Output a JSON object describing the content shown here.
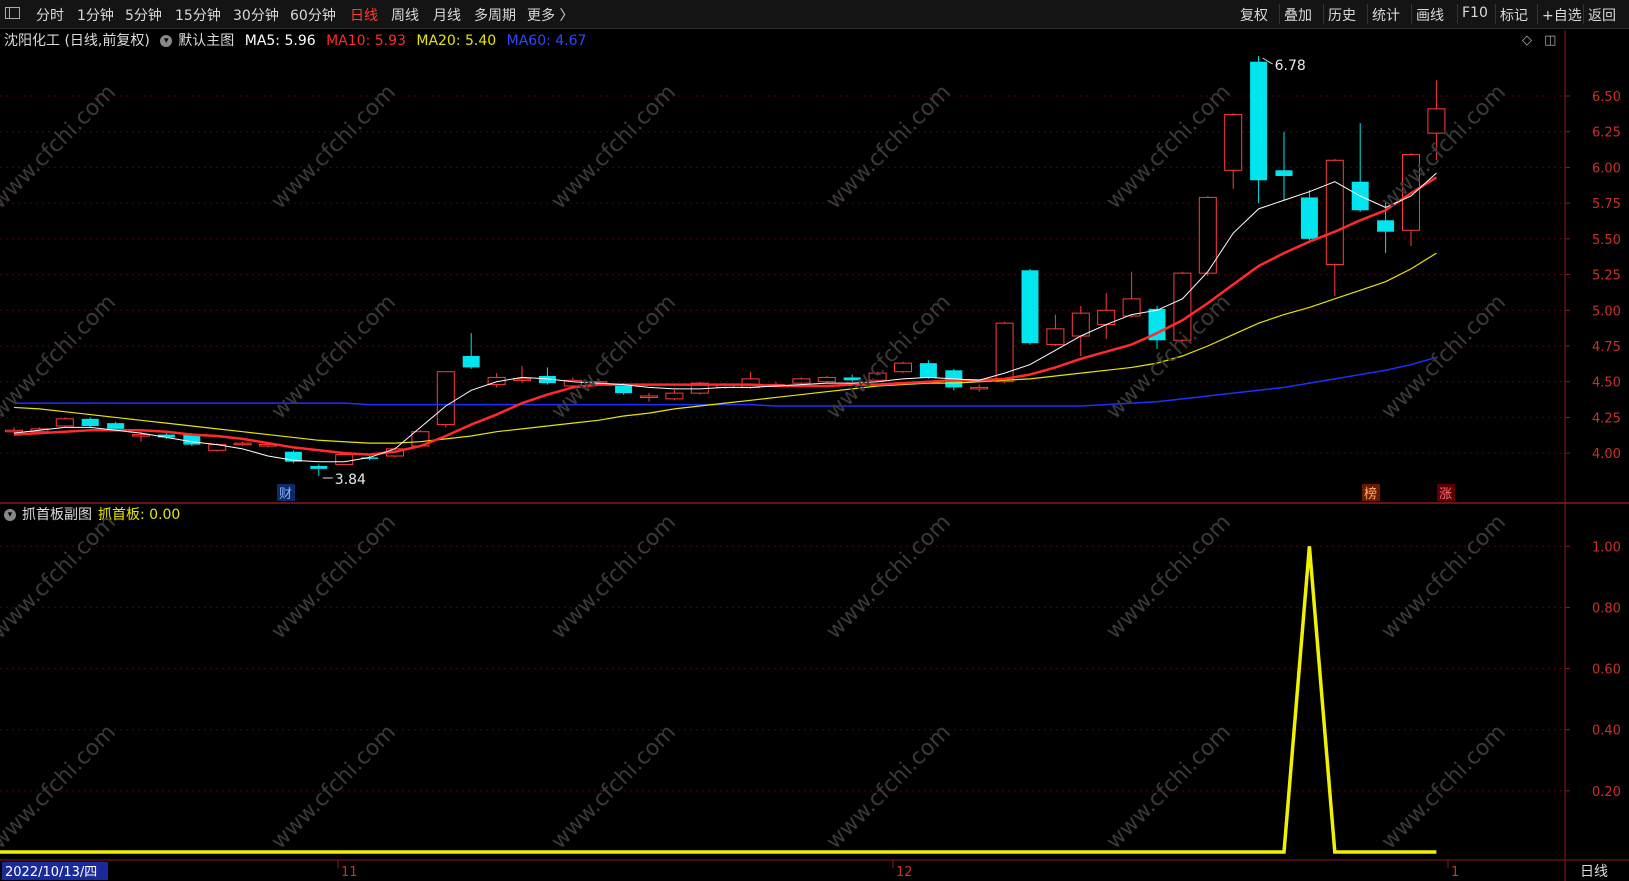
{
  "toolbar": {
    "left_items": [
      "分时",
      "1分钟",
      "5分钟",
      "15分钟",
      "30分钟",
      "60分钟",
      "日线",
      "周线",
      "月线",
      "多周期",
      "更多 〉"
    ],
    "active_item": "日线",
    "right_items": [
      "复权",
      "叠加",
      "历史",
      "统计",
      "画线",
      "F10",
      "标记",
      "+自选",
      "返回"
    ]
  },
  "main_info": {
    "title": "沈阳化工 (日线,前复权)",
    "template": "默认主图",
    "ma5": "MA5: 5.96",
    "ma10": "MA10: 5.93",
    "ma20": "MA20: 5.40",
    "ma60": "MA60: 4.67",
    "colors": {
      "ma5": "#ffffff",
      "ma10": "#ff2a2a",
      "ma20": "#e6e600",
      "ma60": "#1f2fff",
      "up": "#ff3b3b",
      "down": "#00e5ee"
    }
  },
  "sub_info": {
    "title": "抓首板副图",
    "indicator": "抓首板: 0.00"
  },
  "markers": {
    "high_label": "6.78",
    "low_label": "3.84",
    "finance_tag": "财",
    "list_tag": "榜",
    "limit_tag": "涨"
  },
  "watermark": "www.cfchi.com",
  "bottom": {
    "date_label": "2022/10/13/四",
    "month_labels": [
      "11",
      "12",
      "1"
    ],
    "period_label": "日线"
  },
  "chart_data": [
    {
      "type": "candlestick",
      "ylim": [
        3.84,
        6.78
      ],
      "y_ticks": [
        "6.50",
        "6.25",
        "6.00",
        "5.75",
        "5.50",
        "5.25",
        "5.00",
        "4.75",
        "4.50",
        "4.25",
        "4.00"
      ],
      "candles": [
        {
          "o": 4.16,
          "c": 4.16,
          "h": 4.18,
          "l": 4.14
        },
        {
          "o": 4.15,
          "c": 4.17,
          "h": 4.18,
          "l": 4.13
        },
        {
          "o": 4.19,
          "c": 4.24,
          "h": 4.25,
          "l": 4.18
        },
        {
          "o": 4.24,
          "c": 4.19,
          "h": 4.25,
          "l": 4.18
        },
        {
          "o": 4.21,
          "c": 4.17,
          "h": 4.22,
          "l": 4.16
        },
        {
          "o": 4.13,
          "c": 4.13,
          "h": 4.15,
          "l": 4.08
        },
        {
          "o": 4.13,
          "c": 4.11,
          "h": 4.14,
          "l": 4.1
        },
        {
          "o": 4.13,
          "c": 4.06,
          "h": 4.14,
          "l": 4.05
        },
        {
          "o": 4.02,
          "c": 4.06,
          "h": 4.07,
          "l": 4.01
        },
        {
          "o": 4.06,
          "c": 4.07,
          "h": 4.08,
          "l": 4.05
        },
        {
          "o": 4.06,
          "c": 4.06,
          "h": 4.08,
          "l": 4.04
        },
        {
          "o": 4.01,
          "c": 3.94,
          "h": 4.02,
          "l": 3.93
        },
        {
          "o": 3.91,
          "c": 3.89,
          "h": 3.92,
          "l": 3.84
        },
        {
          "o": 3.92,
          "c": 3.99,
          "h": 4.0,
          "l": 3.92
        },
        {
          "o": 3.97,
          "c": 3.96,
          "h": 3.98,
          "l": 3.95
        },
        {
          "o": 3.98,
          "c": 4.03,
          "h": 4.04,
          "l": 3.97
        },
        {
          "o": 4.05,
          "c": 4.15,
          "h": 4.16,
          "l": 4.04
        },
        {
          "o": 4.2,
          "c": 4.57,
          "h": 4.57,
          "l": 4.18
        },
        {
          "o": 4.68,
          "c": 4.6,
          "h": 4.84,
          "l": 4.59
        },
        {
          "o": 4.48,
          "c": 4.53,
          "h": 4.56,
          "l": 4.46
        },
        {
          "o": 4.52,
          "c": 4.52,
          "h": 4.61,
          "l": 4.49
        },
        {
          "o": 4.54,
          "c": 4.49,
          "h": 4.6,
          "l": 4.48
        },
        {
          "o": 4.47,
          "c": 4.51,
          "h": 4.53,
          "l": 4.46
        },
        {
          "o": 4.5,
          "c": 4.5,
          "h": 4.52,
          "l": 4.49
        },
        {
          "o": 4.48,
          "c": 4.42,
          "h": 4.49,
          "l": 4.41
        },
        {
          "o": 4.4,
          "c": 4.4,
          "h": 4.42,
          "l": 4.36
        },
        {
          "o": 4.38,
          "c": 4.42,
          "h": 4.44,
          "l": 4.37
        },
        {
          "o": 4.42,
          "c": 4.49,
          "h": 4.5,
          "l": 4.41
        },
        {
          "o": 4.46,
          "c": 4.48,
          "h": 4.49,
          "l": 4.45
        },
        {
          "o": 4.46,
          "c": 4.52,
          "h": 4.57,
          "l": 4.45
        },
        {
          "o": 4.48,
          "c": 4.48,
          "h": 4.5,
          "l": 4.46
        },
        {
          "o": 4.49,
          "c": 4.52,
          "h": 4.53,
          "l": 4.48
        },
        {
          "o": 4.5,
          "c": 4.53,
          "h": 4.54,
          "l": 4.49
        },
        {
          "o": 4.53,
          "c": 4.51,
          "h": 4.55,
          "l": 4.5
        },
        {
          "o": 4.51,
          "c": 4.56,
          "h": 4.57,
          "l": 4.5
        },
        {
          "o": 4.57,
          "c": 4.63,
          "h": 4.64,
          "l": 4.56
        },
        {
          "o": 4.63,
          "c": 4.53,
          "h": 4.65,
          "l": 4.52
        },
        {
          "o": 4.58,
          "c": 4.46,
          "h": 4.59,
          "l": 4.44
        },
        {
          "o": 4.45,
          "c": 4.46,
          "h": 4.48,
          "l": 4.43
        },
        {
          "o": 4.5,
          "c": 4.91,
          "h": 4.92,
          "l": 4.49
        },
        {
          "o": 5.28,
          "c": 4.77,
          "h": 5.29,
          "l": 4.76
        },
        {
          "o": 4.76,
          "c": 4.87,
          "h": 4.97,
          "l": 4.75
        },
        {
          "o": 4.82,
          "c": 4.98,
          "h": 5.03,
          "l": 4.68
        },
        {
          "o": 4.9,
          "c": 5.0,
          "h": 5.12,
          "l": 4.8
        },
        {
          "o": 4.96,
          "c": 5.08,
          "h": 5.27,
          "l": 4.95
        },
        {
          "o": 5.01,
          "c": 4.79,
          "h": 5.03,
          "l": 4.73
        },
        {
          "o": 4.79,
          "c": 5.26,
          "h": 5.27,
          "l": 4.78
        },
        {
          "o": 5.26,
          "c": 5.79,
          "h": 5.8,
          "l": 5.24
        },
        {
          "o": 5.98,
          "c": 6.37,
          "h": 6.38,
          "l": 5.85
        },
        {
          "o": 6.74,
          "c": 5.91,
          "h": 6.78,
          "l": 5.75
        },
        {
          "o": 5.98,
          "c": 5.94,
          "h": 6.25,
          "l": 5.77
        },
        {
          "o": 5.79,
          "c": 5.5,
          "h": 5.84,
          "l": 5.49
        },
        {
          "o": 5.32,
          "c": 6.05,
          "h": 6.06,
          "l": 5.1
        },
        {
          "o": 5.9,
          "c": 5.7,
          "h": 6.31,
          "l": 5.69
        },
        {
          "o": 5.63,
          "c": 5.55,
          "h": 5.76,
          "l": 5.4
        },
        {
          "o": 5.56,
          "c": 6.09,
          "h": 6.1,
          "l": 5.45
        },
        {
          "o": 6.24,
          "c": 6.41,
          "h": 6.61,
          "l": 6.05
        }
      ],
      "ma5": [
        4.14,
        4.16,
        4.18,
        4.18,
        4.16,
        4.14,
        4.11,
        4.08,
        4.06,
        4.03,
        3.98,
        3.95,
        3.94,
        3.94,
        3.97,
        4.03,
        4.18,
        4.33,
        4.44,
        4.5,
        4.53,
        4.52,
        4.5,
        4.49,
        4.48,
        4.46,
        4.45,
        4.45,
        4.46,
        4.46,
        4.47,
        4.48,
        4.49,
        4.49,
        4.5,
        4.52,
        4.53,
        4.52,
        4.51,
        4.56,
        4.62,
        4.72,
        4.82,
        4.9,
        4.97,
        5.0,
        5.08,
        5.27,
        5.54,
        5.71,
        5.77,
        5.83,
        5.9,
        5.8,
        5.72,
        5.8,
        5.96
      ],
      "ma10": [
        4.13,
        4.14,
        4.15,
        4.16,
        4.16,
        4.16,
        4.15,
        4.13,
        4.12,
        4.1,
        4.07,
        4.04,
        4.02,
        4.0,
        3.99,
        4.01,
        4.05,
        4.12,
        4.2,
        4.27,
        4.35,
        4.41,
        4.46,
        4.48,
        4.48,
        4.48,
        4.48,
        4.48,
        4.48,
        4.48,
        4.47,
        4.47,
        4.47,
        4.48,
        4.48,
        4.49,
        4.5,
        4.51,
        4.51,
        4.52,
        4.55,
        4.6,
        4.66,
        4.71,
        4.76,
        4.84,
        4.93,
        5.05,
        5.18,
        5.31,
        5.4,
        5.48,
        5.55,
        5.63,
        5.7,
        5.82,
        5.93
      ],
      "ma20": [
        4.32,
        4.31,
        4.29,
        4.27,
        4.25,
        4.23,
        4.21,
        4.19,
        4.17,
        4.15,
        4.13,
        4.11,
        4.09,
        4.08,
        4.07,
        4.07,
        4.08,
        4.1,
        4.12,
        4.15,
        4.17,
        4.19,
        4.21,
        4.23,
        4.26,
        4.28,
        4.31,
        4.33,
        4.35,
        4.37,
        4.39,
        4.41,
        4.43,
        4.45,
        4.47,
        4.48,
        4.49,
        4.49,
        4.5,
        4.51,
        4.52,
        4.54,
        4.56,
        4.58,
        4.6,
        4.63,
        4.68,
        4.75,
        4.83,
        4.91,
        4.97,
        5.02,
        5.08,
        5.14,
        5.2,
        5.29,
        5.4
      ],
      "ma60": [
        4.35,
        4.35,
        4.35,
        4.35,
        4.35,
        4.35,
        4.35,
        4.35,
        4.35,
        4.35,
        4.35,
        4.35,
        4.35,
        4.35,
        4.34,
        4.34,
        4.34,
        4.34,
        4.34,
        4.34,
        4.34,
        4.34,
        4.34,
        4.34,
        4.34,
        4.34,
        4.34,
        4.34,
        4.34,
        4.34,
        4.33,
        4.33,
        4.33,
        4.33,
        4.33,
        4.33,
        4.33,
        4.33,
        4.33,
        4.33,
        4.33,
        4.33,
        4.33,
        4.34,
        4.35,
        4.36,
        4.38,
        4.4,
        4.42,
        4.44,
        4.46,
        4.49,
        4.52,
        4.55,
        4.58,
        4.62,
        4.67
      ]
    },
    {
      "type": "line",
      "title": "抓首板",
      "ylim": [
        0,
        1.05
      ],
      "y_ticks": [
        "1.00",
        "0.80",
        "0.60",
        "0.40",
        "0.20"
      ],
      "values": [
        0,
        0,
        0,
        0,
        0,
        0,
        0,
        0,
        0,
        0,
        0,
        0,
        0,
        0,
        0,
        0,
        0,
        0,
        0,
        0,
        0,
        0,
        0,
        0,
        0,
        0,
        0,
        0,
        0,
        0,
        0,
        0,
        0,
        0,
        0,
        0,
        0,
        0,
        0,
        0,
        0,
        0,
        0,
        0,
        0,
        0,
        0,
        0,
        0,
        0,
        0,
        1,
        0,
        0,
        0,
        0,
        0
      ]
    }
  ]
}
